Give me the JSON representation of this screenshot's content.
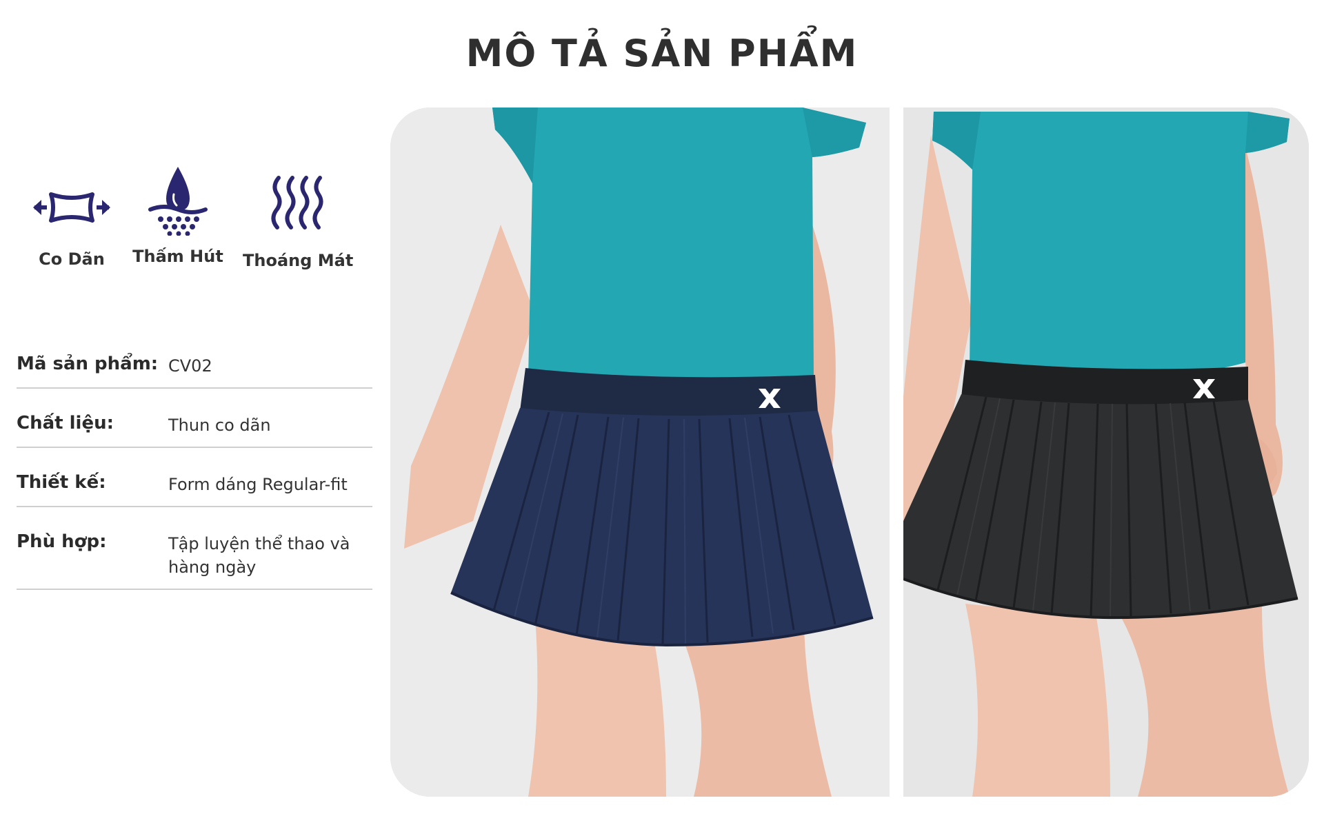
{
  "page": {
    "title": "MÔ TẢ SẢN PHẨM"
  },
  "features": [
    {
      "label": "Co Dãn",
      "icon": "stretch-icon"
    },
    {
      "label": "Thấm Hút",
      "icon": "absorb-drop-icon"
    },
    {
      "label": "Thoáng Mát",
      "icon": "breathable-waves-icon"
    }
  ],
  "specs": [
    {
      "key": "Mã sản phẩm:",
      "value": "CV02"
    },
    {
      "key": "Chất liệu:",
      "value": "Thun co dãn"
    },
    {
      "key": "Thiết kế:",
      "value": "Form dáng Regular-fit"
    },
    {
      "key": "Phù hợp:",
      "value": "Tập luyện thể thao và hàng ngày"
    }
  ],
  "colors": {
    "icon": "#2a2770",
    "shirt": "#22a7b3",
    "skirt_navy": "#24314f",
    "skirt_black": "#2b2d2e",
    "skin": "#f0c6b4"
  },
  "photos": [
    {
      "name": "navy-pleated-skirt-photo",
      "skirt_color": "navy"
    },
    {
      "name": "black-pleated-skirt-photo",
      "skirt_color": "black"
    }
  ]
}
